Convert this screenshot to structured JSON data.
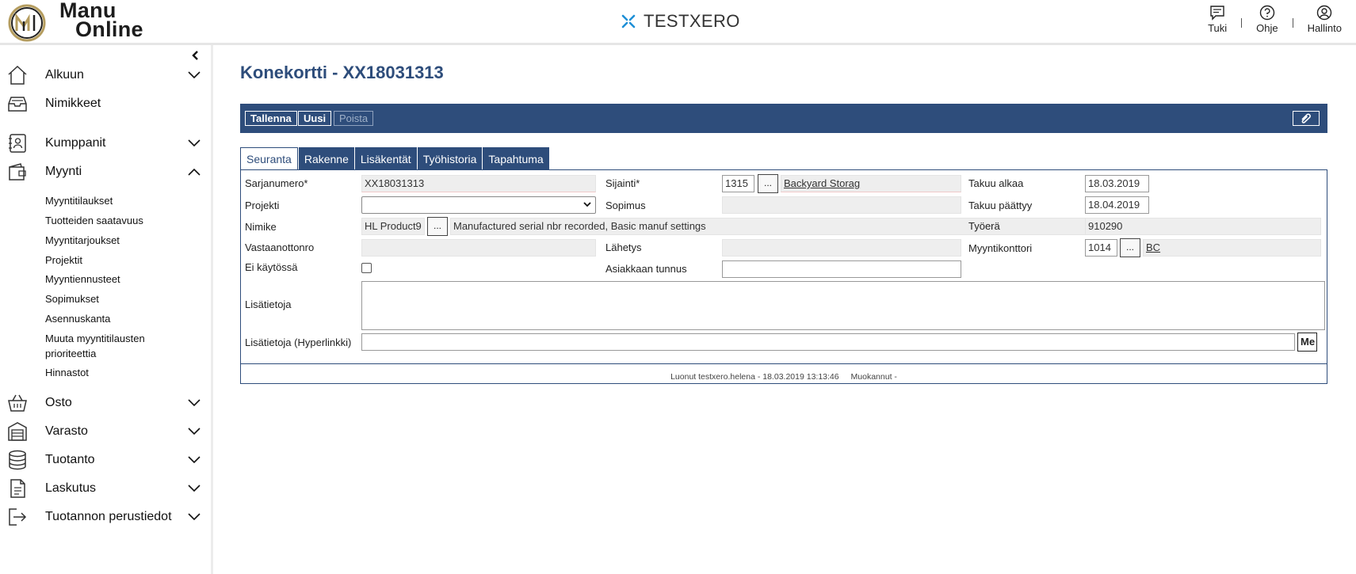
{
  "app": {
    "logo_line1": "Manu",
    "logo_line2": "Online",
    "brand_name": "TESTXERO"
  },
  "header_actions": [
    {
      "label": "Tuki",
      "icon": "chat-icon"
    },
    {
      "label": "Ohje",
      "icon": "help-icon"
    },
    {
      "label": "Hallinto",
      "icon": "user-icon"
    }
  ],
  "sidebar": {
    "items": [
      {
        "label": "Alkuun",
        "icon": "home-icon",
        "expanded": false
      },
      {
        "label": "Nimikkeet",
        "icon": "inbox-icon"
      },
      {
        "label": "Kumppanit",
        "icon": "contacts-icon",
        "expanded": false
      },
      {
        "label": "Myynti",
        "icon": "wallet-icon",
        "expanded": true
      },
      {
        "label": "Osto",
        "icon": "basket-icon",
        "expanded": false
      },
      {
        "label": "Varasto",
        "icon": "warehouse-icon",
        "expanded": false
      },
      {
        "label": "Tuotanto",
        "icon": "database-icon",
        "expanded": false
      },
      {
        "label": "Laskutus",
        "icon": "invoice-icon",
        "expanded": false
      },
      {
        "label": "Tuotannon perustiedot",
        "icon": "exit-icon",
        "expanded": false
      }
    ],
    "myynti_subitems": [
      "Myyntitilaukset",
      "Tuotteiden saatavuus",
      "Myyntitarjoukset",
      "Projektit",
      "Myyntiennusteet",
      "Sopimukset",
      "Asennuskanta",
      "Muuta myyntitilausten prioriteettia",
      "Hinnastot"
    ]
  },
  "page": {
    "title": "Konekortti - XX18031313"
  },
  "toolbar": {
    "save": "Tallenna",
    "new": "Uusi",
    "delete": "Poista"
  },
  "tabs": [
    "Seuranta",
    "Rakenne",
    "Lisäkentät",
    "Työhistoria",
    "Tapahtuma"
  ],
  "form": {
    "sarjanumero_label": "Sarjanumero*",
    "sarjanumero_value": "XX18031313",
    "projekti_label": "Projekti",
    "projekti_value": "",
    "nimike_label": "Nimike",
    "nimike_code": "HL Product9",
    "nimike_desc": "Manufactured serial nbr recorded, Basic manuf settings",
    "vastaanottonro_label": "Vastaanottonro",
    "vastaanottonro_value": "",
    "ei_kaytossa_label": "Ei käytössä",
    "ei_kaytossa_checked": false,
    "sijainti_label": "Sijainti*",
    "sijainti_code": "1315",
    "sijainti_link": "Backyard Storag",
    "sopimus_label": "Sopimus",
    "sopimus_value": "",
    "lahetys_label": "Lähetys",
    "lahetys_value": "",
    "asiakkaan_tunnus_label": "Asiakkaan tunnus",
    "asiakkaan_tunnus_value": "",
    "takuu_alkaa_label": "Takuu alkaa",
    "takuu_alkaa_value": "18.03.2019",
    "takuu_paattyy_label": "Takuu päättyy",
    "takuu_paattyy_value": "18.04.2019",
    "tyoera_label": "Työerä",
    "tyoera_value": "910290",
    "myyntikonttori_label": "Myyntikonttori",
    "myyntikonttori_code": "1014",
    "myyntikonttori_link": "BC",
    "lisatietoja_label": "Lisätietoja",
    "lisatietoja_value": "",
    "hyperlinkki_label": "Lisätietoja (Hyperlinkki)",
    "hyperlinkki_value": "",
    "hyperlinkki_button": "Me",
    "dots": "..."
  },
  "footer": {
    "created": "Luonut testxero.helena - 18.03.2019 13:13:46",
    "modified": "Muokannut -"
  },
  "colors": {
    "accent": "#2e4d7b",
    "brand_icon": "#1e8fd6",
    "logo_gold": "#b59d5f"
  }
}
